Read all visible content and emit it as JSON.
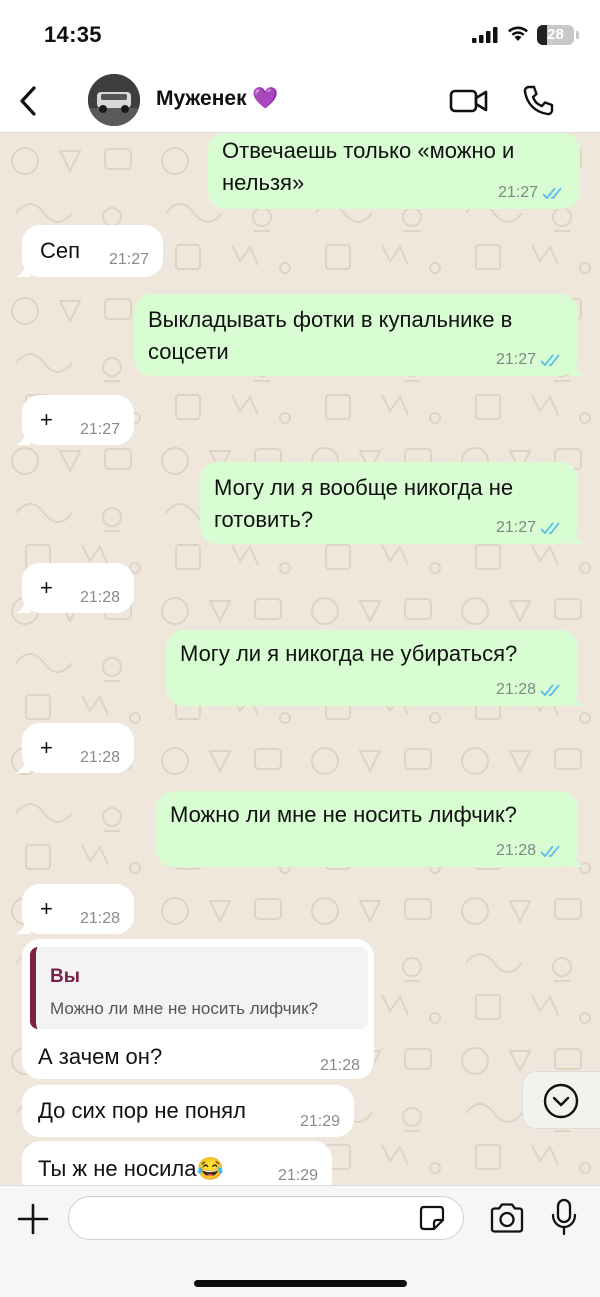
{
  "status_bar": {
    "time": "14:35",
    "battery": "28",
    "battery_level": 0.28
  },
  "header": {
    "contact_name": "Муженек 💜"
  },
  "messages": [
    {
      "text": "Отвечаешь только «можно и нельзя»",
      "time": "21:27",
      "direction": "out"
    },
    {
      "text": "Сеп",
      "time": "21:27",
      "direction": "in"
    },
    {
      "text": "Выкладывать фотки в купальнике в соцсети",
      "time": "21:27",
      "direction": "out"
    },
    {
      "text": "+",
      "time": "21:27",
      "direction": "in"
    },
    {
      "text": "Могу ли я вообще никогда не готовить?",
      "time": "21:27",
      "direction": "out"
    },
    {
      "text": "+",
      "time": "21:28",
      "direction": "in"
    },
    {
      "text": "Могу ли я никогда не убираться?",
      "time": "21:28",
      "direction": "out"
    },
    {
      "text": "+",
      "time": "21:28",
      "direction": "in"
    },
    {
      "text": "Можно ли мне не носить лифчик?",
      "time": "21:28",
      "direction": "out"
    },
    {
      "text": "+",
      "time": "21:28",
      "direction": "in"
    },
    {
      "text": "А зачем он?",
      "time": "21:28",
      "direction": "in",
      "reply_to": {
        "author": "Вы",
        "text": "Можно ли мне не носить лифчик?"
      }
    },
    {
      "text": "До сих пор не понял",
      "time": "21:29",
      "direction": "in"
    },
    {
      "text": "Ты ж не носила😂",
      "time": "21:29",
      "direction": "in"
    }
  ],
  "input": {
    "value": "",
    "placeholder": ""
  },
  "colors": {
    "outgoing_bubble": "#d9fdd3",
    "incoming_bubble": "#ffffff",
    "read_ticks": "#53bdeb",
    "wallpaper": "#efe7dc",
    "quote_accent": "#7a2148"
  },
  "icons": [
    "back-icon",
    "video-call-icon",
    "phone-icon",
    "double-check-icon",
    "chevron-down-icon",
    "plus-icon",
    "sticker-icon",
    "camera-icon",
    "microphone-icon"
  ]
}
